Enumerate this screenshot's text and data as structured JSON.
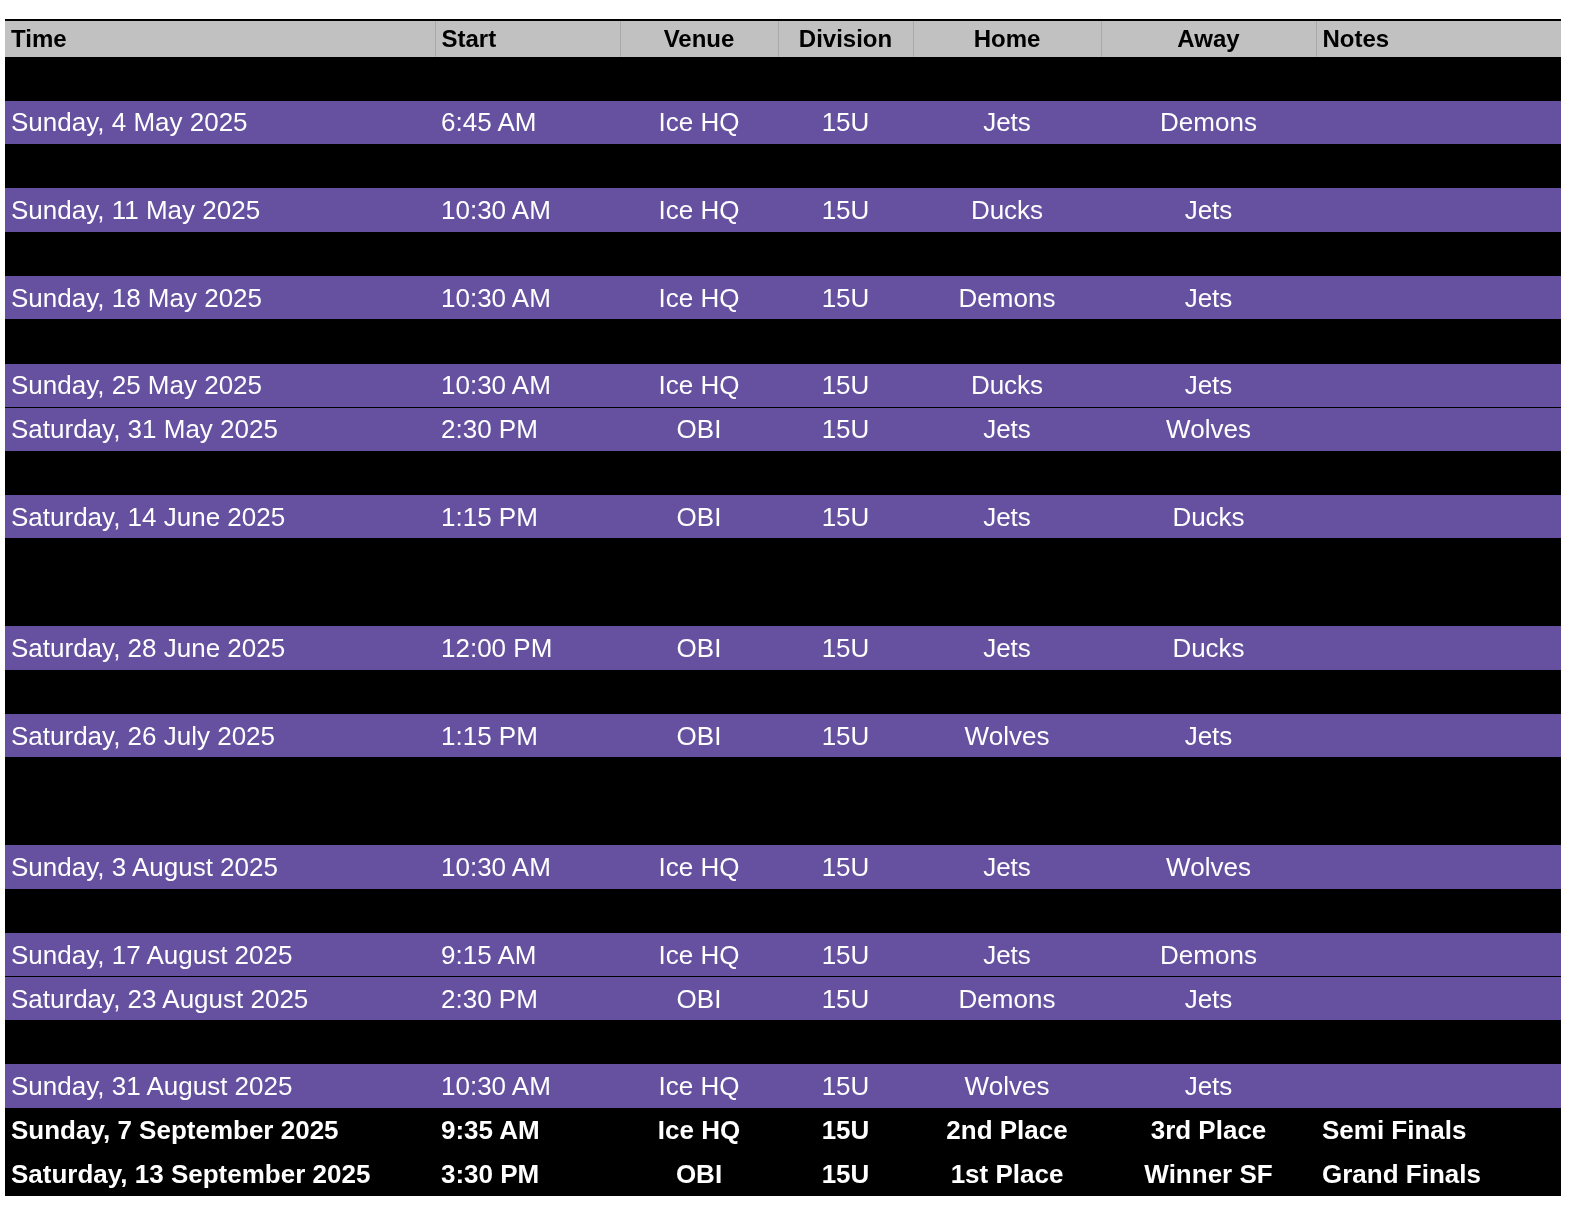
{
  "table": {
    "columns": [
      "Time",
      "Start",
      "Venue",
      "Division",
      "Home",
      "Away",
      "Notes"
    ],
    "rows": [
      {
        "kind": "blank"
      },
      {
        "kind": "game",
        "cells": [
          "Sunday, 4 May 2025",
          "6:45 AM",
          "Ice HQ",
          "15U",
          "Jets",
          "Demons"
        ]
      },
      {
        "kind": "blank"
      },
      {
        "kind": "game",
        "cells": [
          "Sunday, 11 May 2025",
          "10:30 AM",
          "Ice HQ",
          "15U",
          "Ducks",
          "Jets"
        ]
      },
      {
        "kind": "blank"
      },
      {
        "kind": "game",
        "cells": [
          "Sunday, 18 May 2025",
          "10:30 AM",
          "Ice HQ",
          "15U",
          "Demons",
          "Jets"
        ]
      },
      {
        "kind": "blank"
      },
      {
        "kind": "game",
        "cells": [
          "Sunday, 25 May 2025",
          "10:30 AM",
          "Ice HQ",
          "15U",
          "Ducks",
          "Jets"
        ]
      },
      {
        "kind": "game",
        "cells": [
          "Saturday, 31 May 2025",
          "2:30 PM",
          "OBI",
          "15U",
          "Jets",
          "Wolves"
        ]
      },
      {
        "kind": "blank"
      },
      {
        "kind": "game",
        "cells": [
          "Saturday, 14 June 2025",
          "1:15 PM",
          "OBI",
          "15U",
          "Jets",
          "Ducks"
        ]
      },
      {
        "kind": "blank"
      },
      {
        "kind": "blank"
      },
      {
        "kind": "game",
        "cells": [
          "Saturday, 28 June 2025",
          "12:00 PM",
          "OBI",
          "15U",
          "Jets",
          "Ducks"
        ]
      },
      {
        "kind": "blank"
      },
      {
        "kind": "game",
        "cells": [
          "Saturday, 26 July 2025",
          "1:15 PM",
          "OBI",
          "15U",
          "Wolves",
          "Jets"
        ]
      },
      {
        "kind": "blank"
      },
      {
        "kind": "blank"
      },
      {
        "kind": "game",
        "cells": [
          "Sunday, 3 August 2025",
          "10:30 AM",
          "Ice HQ",
          "15U",
          "Jets",
          "Wolves"
        ]
      },
      {
        "kind": "blank"
      },
      {
        "kind": "game",
        "cells": [
          "Sunday, 17 August 2025",
          "9:15 AM",
          "Ice HQ",
          "15U",
          "Jets",
          "Demons"
        ]
      },
      {
        "kind": "game",
        "cells": [
          "Saturday, 23 August 2025",
          "2:30 PM",
          "OBI",
          "15U",
          "Demons",
          "Jets"
        ]
      },
      {
        "kind": "blank"
      },
      {
        "kind": "game",
        "cells": [
          "Sunday, 31 August 2025",
          "10:30 AM",
          "Ice HQ",
          "15U",
          "Wolves",
          "Jets"
        ]
      },
      {
        "kind": "final",
        "cells": [
          "Sunday, 7 September 2025",
          "9:35 AM",
          "Ice HQ",
          "15U",
          "2nd Place",
          "3rd Place",
          "Semi Finals"
        ]
      },
      {
        "kind": "final",
        "cells": [
          "Saturday, 13 September 2025",
          "3:30 PM",
          "OBI",
          "15U",
          "1st Place",
          "Winner SF",
          "Grand Finals"
        ]
      }
    ]
  }
}
